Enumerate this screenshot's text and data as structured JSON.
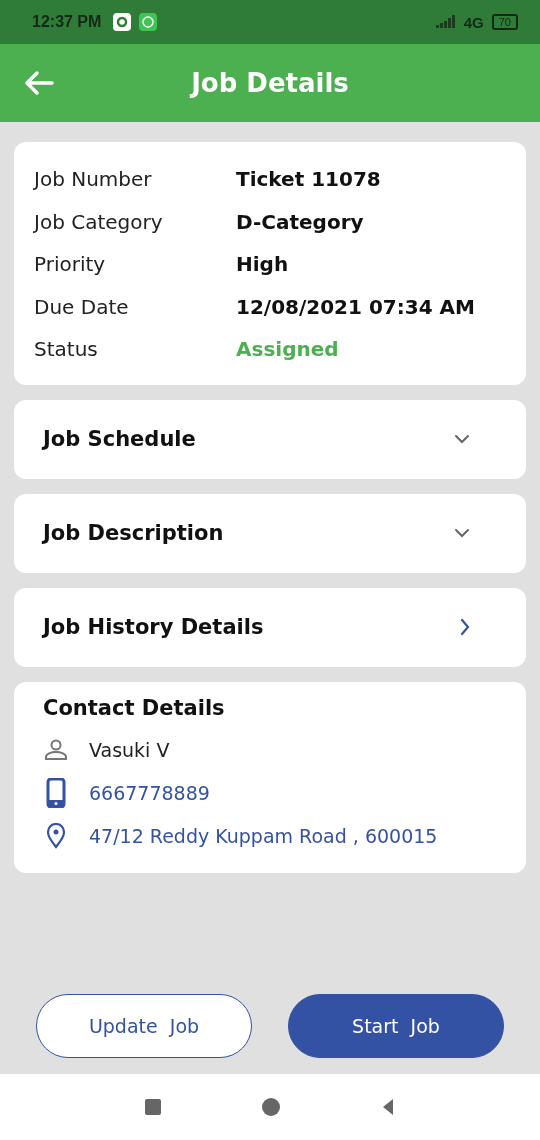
{
  "status_bar": {
    "time": "12:37 PM",
    "network": "4G",
    "battery": "70"
  },
  "app_bar": {
    "title": "Job Details"
  },
  "details": [
    {
      "label": "Job Number",
      "value": "Ticket 11078",
      "kind": "plain"
    },
    {
      "label": "Job Category",
      "value": "D-Category",
      "kind": "plain"
    },
    {
      "label": "Priority",
      "value": "High",
      "kind": "plain"
    },
    {
      "label": "Due Date",
      "value": "12/08/2021 07:34 AM",
      "kind": "plain"
    },
    {
      "label": "Status",
      "value": "Assigned",
      "kind": "status"
    }
  ],
  "sections": [
    {
      "title": "Job Schedule",
      "kind": "collapsible",
      "expanded": false
    },
    {
      "title": "Job Description",
      "kind": "collapsible",
      "expanded": false
    },
    {
      "title": "Job History Details",
      "kind": "link"
    }
  ],
  "contact": {
    "title": "Contact Details",
    "rows": [
      {
        "kind": "person",
        "text": "Vasuki V"
      },
      {
        "kind": "phone",
        "text": "6667778889"
      },
      {
        "kind": "location",
        "text": "47/12 Reddy Kuppam Road , 600015"
      }
    ]
  },
  "buttons": [
    {
      "label": "Update  Job",
      "kind": "outline"
    },
    {
      "label": "Start  Job",
      "kind": "filled"
    }
  ]
}
